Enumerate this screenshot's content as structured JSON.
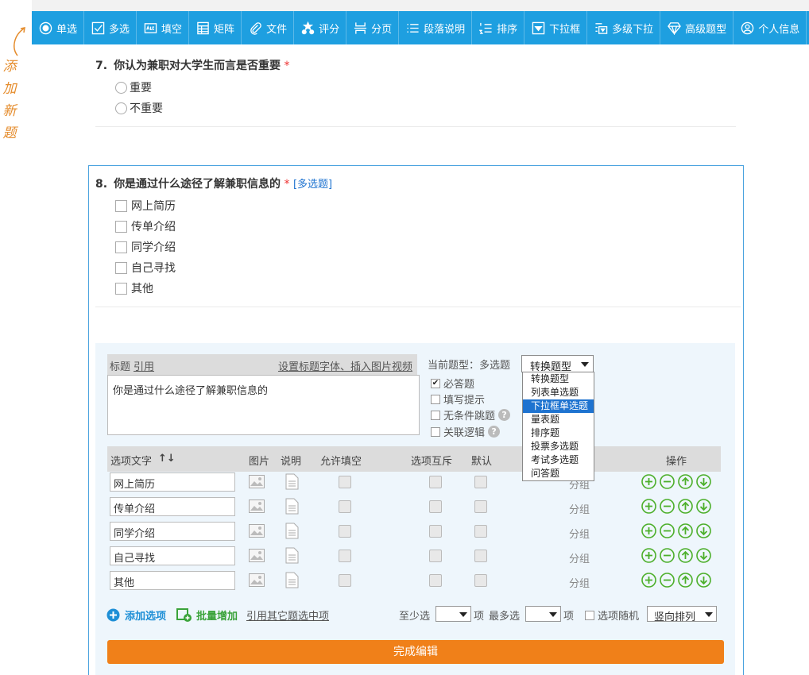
{
  "side_label_chars": [
    "添",
    "加",
    "新",
    "题"
  ],
  "toolbar": [
    {
      "label": "单选",
      "icon": "radio-circle-icon"
    },
    {
      "label": "多选",
      "icon": "checkbox-icon"
    },
    {
      "label": "填空",
      "icon": "abc-field-icon"
    },
    {
      "label": "矩阵",
      "icon": "matrix-icon"
    },
    {
      "label": "文件",
      "icon": "paperclip-icon"
    },
    {
      "label": "评分",
      "icon": "star-icon"
    },
    {
      "label": "分页",
      "icon": "page-break-icon"
    },
    {
      "label": "段落说明",
      "icon": "paragraph-icon"
    },
    {
      "label": "排序",
      "icon": "sort-list-icon"
    },
    {
      "label": "下拉框",
      "icon": "dropdown-icon"
    },
    {
      "label": "多级下拉",
      "icon": "multilevel-dropdown-icon"
    },
    {
      "label": "高级题型",
      "icon": "diamond-icon"
    },
    {
      "label": "个人信息",
      "icon": "person-icon"
    }
  ],
  "q7": {
    "num": "7.",
    "title": "你认为兼职对大学生而言是否重要",
    "required": "*",
    "options": [
      "重要",
      "不重要"
    ]
  },
  "q8": {
    "num": "8.",
    "title": "你是通过什么途径了解兼职信息的",
    "required": "*",
    "tag": "[多选题]",
    "options": [
      "网上简历",
      "传单介绍",
      "同学介绍",
      "自己寻找",
      "其他"
    ]
  },
  "editor": {
    "title_label": "标题",
    "quote_link": "引用",
    "font_link": "设置标题字体、插入图片视频",
    "title_value": "你是通过什么途径了解兼职信息的",
    "qtype_label": "当前题型：多选题",
    "convert_select": "转换题型",
    "convert_options": [
      "转换题型",
      "列表单选题",
      "下拉框单选题",
      "量表题",
      "排序题",
      "投票多选题",
      "考试多选题",
      "问答题"
    ],
    "convert_highlighted": 2,
    "required_label": "必答题",
    "hint_label": "填写提示",
    "skip_label": "无条件跳题",
    "logic_label": "关联逻辑",
    "required_mark": "✔",
    "help_mark": "?",
    "columns": {
      "option_text": "选项文字",
      "sort_mark": "↑↓",
      "image": "图片",
      "desc": "说明",
      "allow_fill": "允许填空",
      "exclusive": "选项互斥",
      "default": "默认",
      "ops": "操作"
    },
    "rows": [
      "网上简历",
      "传单介绍",
      "同学介绍",
      "自己寻找",
      "其他"
    ],
    "group_label": "分组",
    "add_option": "添加选项",
    "batch_add": "批量增加",
    "quote_other": "引用其它题选中项",
    "min_label": "至少选",
    "item_unit": "项",
    "max_label": "最多选",
    "random_label": "选项随机",
    "order_select": "竖向排列",
    "finish": "完成编辑"
  }
}
